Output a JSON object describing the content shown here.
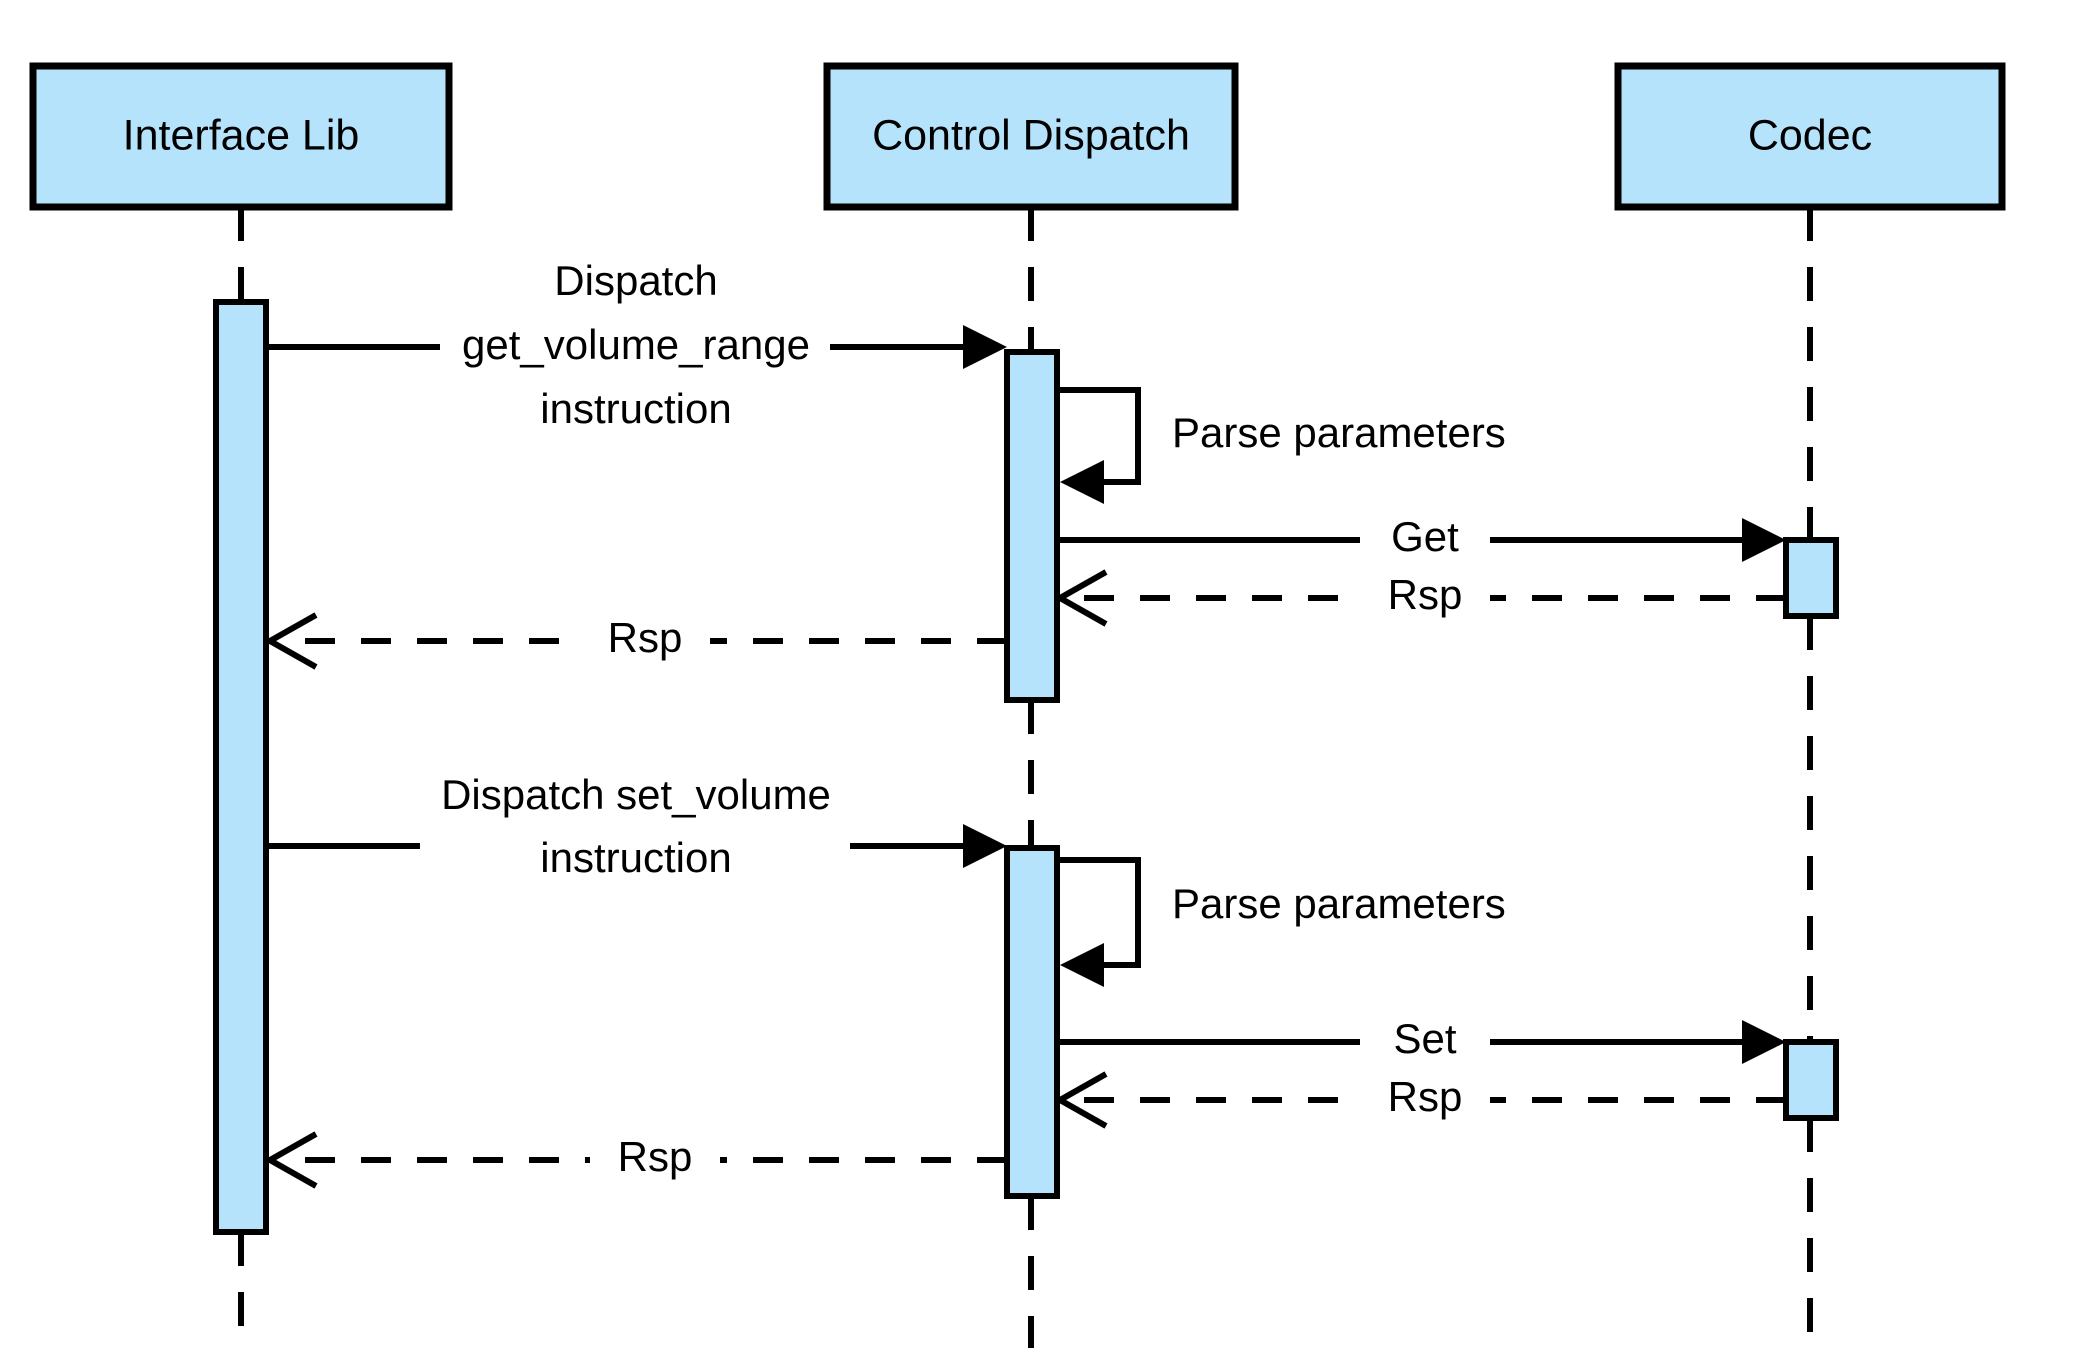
{
  "diagram": {
    "type": "uml-sequence-diagram",
    "background_color": "#ffffff",
    "line_color": "#000000",
    "participant_fill": "#b5e3fb",
    "activation_fill": "#b5e3fb"
  },
  "participants": [
    {
      "id": "interface_lib",
      "label": "Interface Lib"
    },
    {
      "id": "control_dispatch",
      "label": "Control Dispatch"
    },
    {
      "id": "codec",
      "label": "Codec"
    }
  ],
  "messages": [
    {
      "id": "m1",
      "from": "interface_lib",
      "to": "control_dispatch",
      "label_lines": [
        "Dispatch",
        "get_volume_range",
        "instruction"
      ],
      "style": "solid",
      "arrow": "filled"
    },
    {
      "id": "m2",
      "from": "control_dispatch",
      "to": "control_dispatch",
      "label_lines": [
        "Parse parameters"
      ],
      "style": "self",
      "arrow": "filled"
    },
    {
      "id": "m3",
      "from": "control_dispatch",
      "to": "codec",
      "label_lines": [
        "Get"
      ],
      "style": "solid",
      "arrow": "filled"
    },
    {
      "id": "m4",
      "from": "codec",
      "to": "control_dispatch",
      "label_lines": [
        "Rsp"
      ],
      "style": "dashed",
      "arrow": "open"
    },
    {
      "id": "m5",
      "from": "control_dispatch",
      "to": "interface_lib",
      "label_lines": [
        "Rsp"
      ],
      "style": "dashed",
      "arrow": "open"
    },
    {
      "id": "m6",
      "from": "interface_lib",
      "to": "control_dispatch",
      "label_lines": [
        "Dispatch set_volume",
        "instruction"
      ],
      "style": "solid",
      "arrow": "filled"
    },
    {
      "id": "m7",
      "from": "control_dispatch",
      "to": "control_dispatch",
      "label_lines": [
        "Parse parameters"
      ],
      "style": "self",
      "arrow": "filled"
    },
    {
      "id": "m8",
      "from": "control_dispatch",
      "to": "codec",
      "label_lines": [
        "Set"
      ],
      "style": "solid",
      "arrow": "filled"
    },
    {
      "id": "m9",
      "from": "codec",
      "to": "control_dispatch",
      "label_lines": [
        "Rsp"
      ],
      "style": "dashed",
      "arrow": "open"
    },
    {
      "id": "m10",
      "from": "control_dispatch",
      "to": "interface_lib",
      "label_lines": [
        "Rsp"
      ],
      "style": "dashed",
      "arrow": "open"
    }
  ],
  "labels": {
    "p0_title": "Interface Lib",
    "p1_title": "Control Dispatch",
    "p2_title": "Codec",
    "m1_l0": "Dispatch",
    "m1_l1": "get_volume_range",
    "m1_l2": "instruction",
    "m2_text": "Parse parameters",
    "m3_text": "Get",
    "m4_text": "Rsp",
    "m5_text": "Rsp",
    "m6_l0": "Dispatch set_volume",
    "m6_l1": "instruction",
    "m7_text": "Parse parameters",
    "m8_text": "Set",
    "m9_text": "Rsp",
    "m10_text": "Rsp"
  }
}
